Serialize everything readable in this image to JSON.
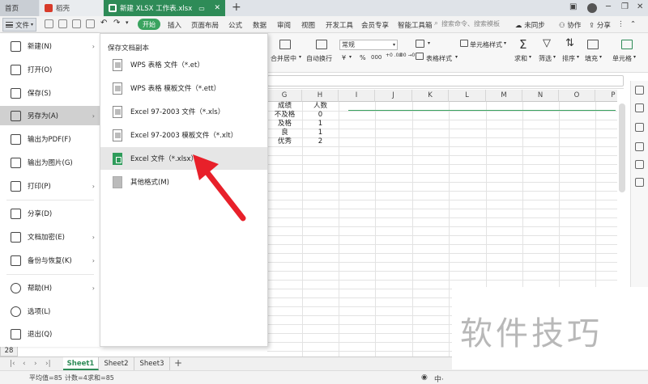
{
  "tabs": {
    "home": "首页",
    "doc1": "稻壳",
    "active": "新建 XLSX 工作表.xlsx"
  },
  "menu": {
    "file": "文件",
    "start": "开始",
    "items": [
      "插入",
      "页面布局",
      "公式",
      "数据",
      "审阅",
      "视图",
      "开发工具",
      "会员专享",
      "智能工具箱"
    ],
    "search": "搜索命令、搜索模板",
    "unsync": "未同步",
    "collab": "协作",
    "share": "分享"
  },
  "ribbon": {
    "merge": "合并居中",
    "wrap": "自动换行",
    "format": "常规",
    "currency": "¥",
    "percent": "%",
    "thousands": "000",
    "dec_inc": "+0 .00",
    "dec_dec": ".00 →0",
    "table_style": "表格样式",
    "cell_style": "单元格样式",
    "sum": "求和",
    "filter": "筛选",
    "sort": "排序",
    "fill": "填充",
    "cell": "单元格"
  },
  "grid": {
    "columns": [
      "G",
      "H",
      "I",
      "J",
      "K",
      "L",
      "M",
      "N",
      "O",
      "P"
    ],
    "rows": [
      [
        "成绩",
        "人数"
      ],
      [
        "不及格",
        "0"
      ],
      [
        "及格",
        "1"
      ],
      [
        "良",
        "1"
      ],
      [
        "优秀",
        "2"
      ]
    ],
    "visible_row_number": "28"
  },
  "file_menu": {
    "items": [
      {
        "label": "新建(N)",
        "icon": "new-file-icon",
        "arrow": true
      },
      {
        "label": "打开(O)",
        "icon": "open-folder-icon",
        "arrow": false
      },
      {
        "label": "保存(S)",
        "icon": "save-icon",
        "arrow": false
      },
      {
        "label": "另存为(A)",
        "icon": "save-as-icon",
        "arrow": true
      },
      {
        "label": "输出为PDF(F)",
        "icon": "pdf-icon",
        "arrow": false
      },
      {
        "label": "输出为图片(G)",
        "icon": "image-icon",
        "arrow": false
      },
      {
        "label": "打印(P)",
        "icon": "print-icon",
        "arrow": true
      },
      {
        "label": "分享(D)",
        "icon": "share-icon",
        "arrow": false
      },
      {
        "label": "文档加密(E)",
        "icon": "lock-icon",
        "arrow": true
      },
      {
        "label": "备份与恢复(K)",
        "icon": "backup-icon",
        "arrow": true
      },
      {
        "label": "帮助(H)",
        "icon": "help-icon",
        "arrow": true
      },
      {
        "label": "选项(L)",
        "icon": "gear-icon",
        "arrow": false
      },
      {
        "label": "退出(Q)",
        "icon": "exit-icon",
        "arrow": false
      }
    ]
  },
  "save_as_submenu": {
    "title": "保存文档副本",
    "items": [
      "WPS 表格 文件（*.et）",
      "WPS 表格 模板文件（*.ett）",
      "Excel 97-2003 文件（*.xls）",
      "Excel 97-2003 模板文件（*.xlt）",
      "Excel 文件（*.xlsx）",
      "其他格式(M)"
    ]
  },
  "sheets": [
    "Sheet1",
    "Sheet2",
    "Sheet3"
  ],
  "status": {
    "avg": "平均值=85",
    "count": "计数=4",
    "sum": "求和=85"
  },
  "watermark": "软件技巧",
  "colors": {
    "accent": "#2e8b57",
    "arrow": "#e8202a"
  }
}
